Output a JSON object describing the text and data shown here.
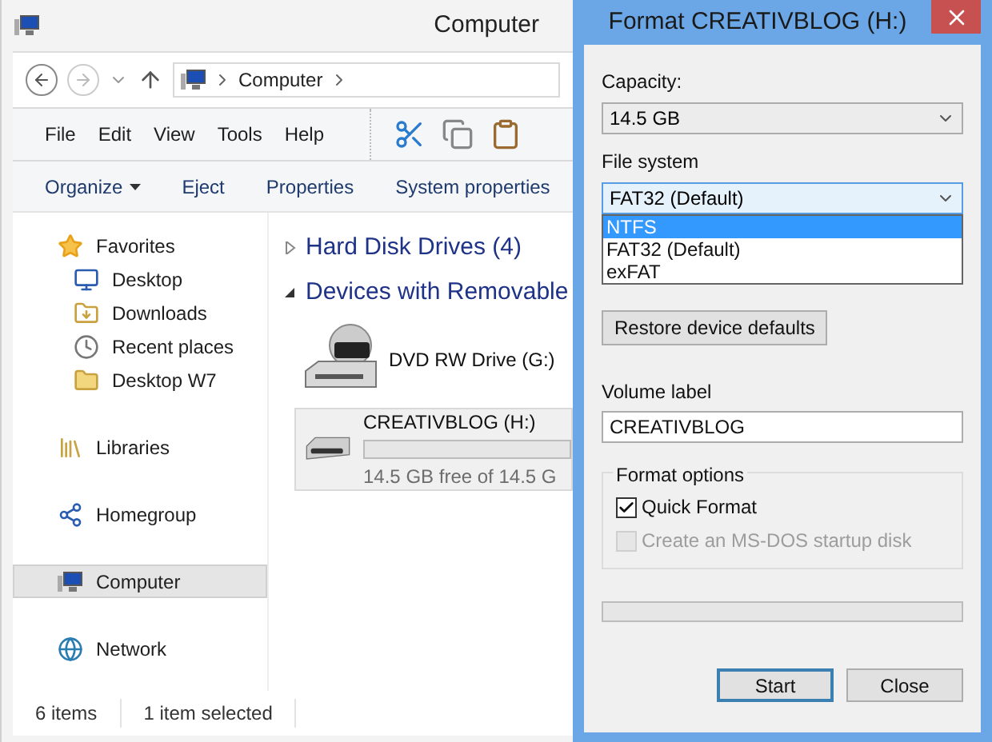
{
  "explorer": {
    "title": "Computer",
    "address": {
      "path": [
        "Computer"
      ]
    },
    "menu": [
      "File",
      "Edit",
      "View",
      "Tools",
      "Help"
    ],
    "commands": [
      {
        "label": "Organize",
        "has_menu": true
      },
      {
        "label": "Eject",
        "has_menu": false
      },
      {
        "label": "Properties",
        "has_menu": false
      },
      {
        "label": "System properties",
        "has_menu": false
      }
    ],
    "nav": [
      {
        "label": "Favorites",
        "kind": "favorites",
        "selected": false,
        "children": [
          {
            "label": "Desktop",
            "kind": "desktop",
            "selected": false
          },
          {
            "label": "Downloads",
            "kind": "downloads",
            "selected": false
          },
          {
            "label": "Recent places",
            "kind": "recent",
            "selected": false
          },
          {
            "label": "Desktop W7",
            "kind": "folder",
            "selected": false
          }
        ]
      },
      {
        "label": "Libraries",
        "kind": "libraries",
        "selected": false
      },
      {
        "label": "Homegroup",
        "kind": "homegroup",
        "selected": false
      },
      {
        "label": "Computer",
        "kind": "computer",
        "selected": true
      },
      {
        "label": "Network",
        "kind": "network",
        "selected": false
      }
    ],
    "groups": [
      {
        "title": "Hard Disk Drives (4)",
        "expanded": false
      },
      {
        "title": "Devices with Removable",
        "expanded": true,
        "items": [
          {
            "name": "DVD RW Drive (G:)",
            "kind": "dvd",
            "selected": false
          },
          {
            "name": "CREATIVBLOG (H:)",
            "kind": "removable",
            "selected": true,
            "level": 0,
            "detail": "14.5 GB free of 14.5 G"
          }
        ]
      }
    ],
    "status_bar": [
      "6 items",
      "1 item selected"
    ]
  },
  "dialog": {
    "title": "Format CREATIVBLOG (H:)",
    "capacity": {
      "label": "Capacity:",
      "value": "14.5 GB"
    },
    "file_system": {
      "label": "File system",
      "value": "FAT32 (Default)",
      "open": true,
      "options": [
        {
          "label": "NTFS",
          "highlighted": true
        },
        {
          "label": "FAT32 (Default)",
          "highlighted": false
        },
        {
          "label": "exFAT",
          "highlighted": false
        }
      ]
    },
    "restore_button": "Restore device defaults",
    "volume_label": {
      "label": "Volume label",
      "value": "CREATIVBLOG"
    },
    "format_options": {
      "title": "Format options",
      "options": [
        {
          "label": "Quick Format",
          "checked": true,
          "disabled": false
        },
        {
          "label": "Create an MS-DOS startup disk",
          "checked": false,
          "disabled": true
        }
      ]
    },
    "progress": {
      "level": 0
    },
    "buttons": [
      {
        "label": "Start",
        "default": true
      },
      {
        "label": "Close",
        "default": false
      }
    ]
  }
}
